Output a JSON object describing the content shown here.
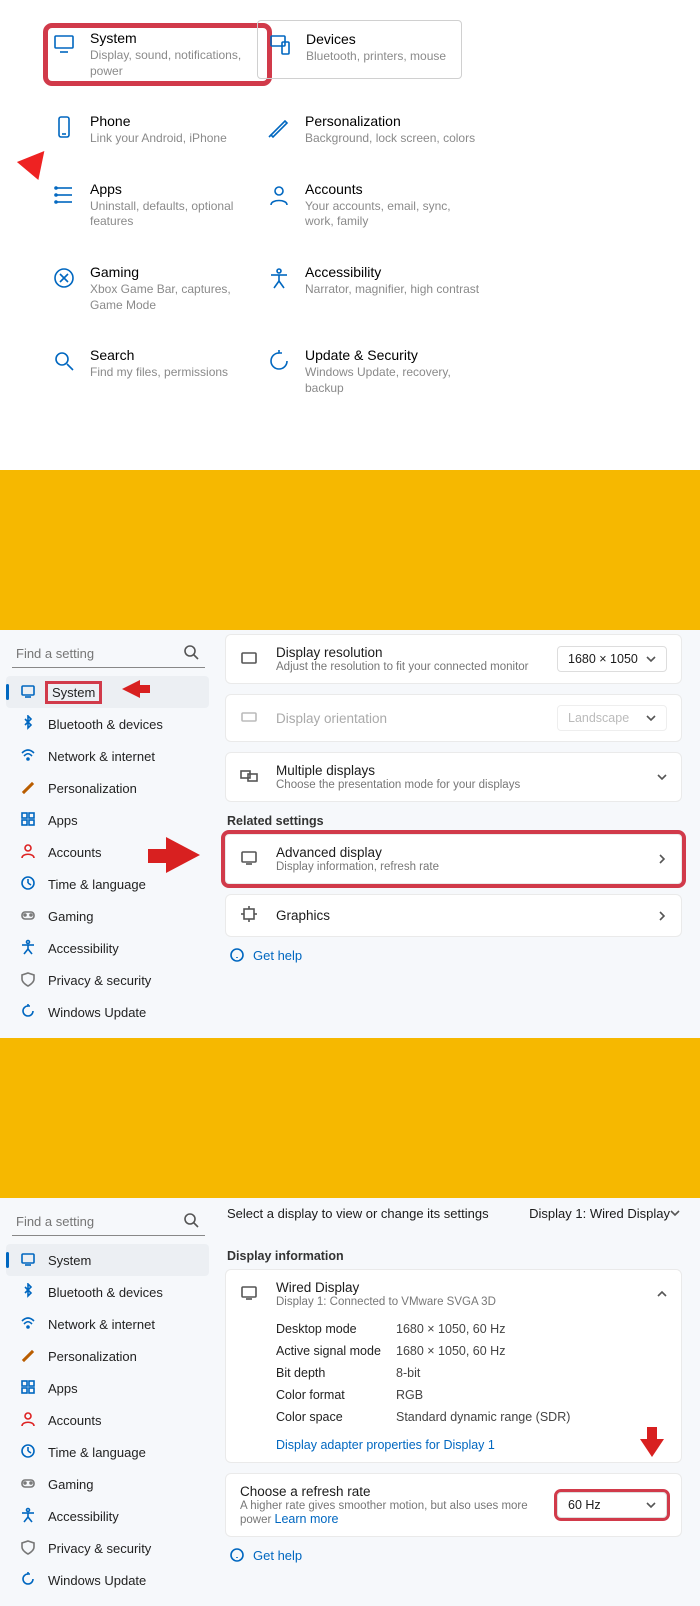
{
  "panel1": {
    "cats": [
      {
        "id": "system",
        "title": "System",
        "desc": "Display, sound, notifications, power",
        "hl": true
      },
      {
        "id": "devices",
        "title": "Devices",
        "desc": "Bluetooth, printers, mouse",
        "box": true
      },
      {
        "id": "phone",
        "title": "Phone",
        "desc": "Link your Android, iPhone"
      },
      {
        "id": "personalization",
        "title": "Personalization",
        "desc": "Background, lock screen, colors"
      },
      {
        "id": "apps",
        "title": "Apps",
        "desc": "Uninstall, defaults, optional features"
      },
      {
        "id": "accounts",
        "title": "Accounts",
        "desc": "Your accounts, email, sync, work, family"
      },
      {
        "id": "gaming",
        "title": "Gaming",
        "desc": "Xbox Game Bar, captures, Game Mode"
      },
      {
        "id": "accessibility",
        "title": "Accessibility",
        "desc": "Narrator, magnifier, high contrast"
      },
      {
        "id": "search",
        "title": "Search",
        "desc": "Find my files, permissions"
      },
      {
        "id": "update",
        "title": "Update & Security",
        "desc": "Windows Update, recovery, backup"
      }
    ]
  },
  "sidebar": {
    "search_placeholder": "Find a setting",
    "items": [
      {
        "id": "system",
        "label": "System"
      },
      {
        "id": "bluetooth",
        "label": "Bluetooth & devices"
      },
      {
        "id": "network",
        "label": "Network & internet"
      },
      {
        "id": "personalization",
        "label": "Personalization"
      },
      {
        "id": "apps",
        "label": "Apps"
      },
      {
        "id": "accounts",
        "label": "Accounts"
      },
      {
        "id": "time",
        "label": "Time & language"
      },
      {
        "id": "gaming",
        "label": "Gaming"
      },
      {
        "id": "accessibility",
        "label": "Accessibility"
      },
      {
        "id": "privacy",
        "label": "Privacy & security"
      },
      {
        "id": "update",
        "label": "Windows Update"
      }
    ]
  },
  "panel2": {
    "cards": {
      "res": {
        "title": "Display resolution",
        "desc": "Adjust the resolution to fit your connected monitor",
        "value": "1680 × 1050"
      },
      "orient": {
        "title": "Display orientation",
        "value": "Landscape"
      },
      "multi": {
        "title": "Multiple displays",
        "desc": "Choose the presentation mode for your displays"
      },
      "adv": {
        "title": "Advanced display",
        "desc": "Display information, refresh rate"
      },
      "gfx": {
        "title": "Graphics"
      }
    },
    "related": "Related settings",
    "gethelp": "Get help"
  },
  "panel3": {
    "top_label": "Select a display to view or change its settings",
    "top_value": "Display 1: Wired Display",
    "section": "Display information",
    "wired": {
      "title": "Wired Display",
      "desc": "Display 1: Connected to VMware SVGA 3D"
    },
    "rows": [
      {
        "k": "Desktop mode",
        "v": "1680 × 1050, 60 Hz"
      },
      {
        "k": "Active signal mode",
        "v": "1680 × 1050, 60 Hz"
      },
      {
        "k": "Bit depth",
        "v": "8-bit"
      },
      {
        "k": "Color format",
        "v": "RGB"
      },
      {
        "k": "Color space",
        "v": "Standard dynamic range (SDR)"
      }
    ],
    "adapter_link": "Display adapter properties for Display 1",
    "refresh": {
      "title": "Choose a refresh rate",
      "desc": "A higher rate gives smoother motion, but also uses more power  ",
      "learn": "Learn more",
      "value": "60 Hz"
    },
    "gethelp": "Get help"
  }
}
